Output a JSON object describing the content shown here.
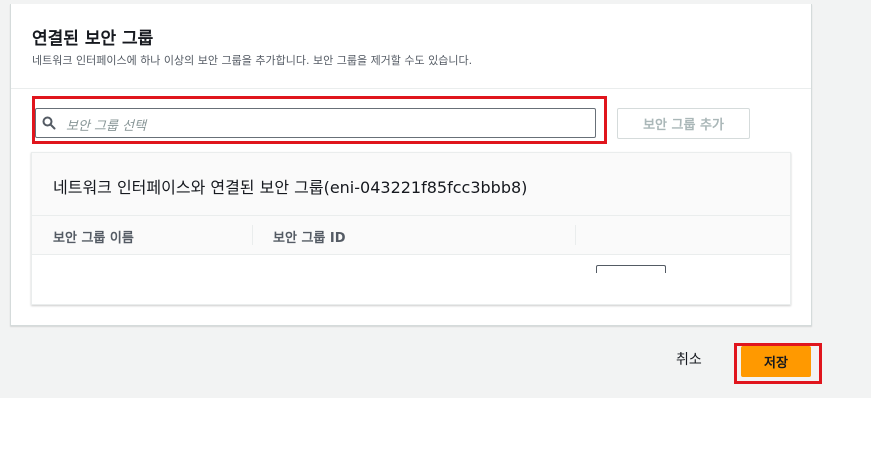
{
  "panel": {
    "title": "연결된 보안 그룹",
    "description": "네트워크 인터페이스에 하나 이상의 보안 그룹을 추가합니다. 보안 그룹을 제거할 수도 있습니다."
  },
  "search": {
    "placeholder": "보안 그룹 선택",
    "icon": "search-icon"
  },
  "add_button": {
    "label": "보안 그룹 추가"
  },
  "table": {
    "title": "네트워크 인터페이스와 연결된 보안 그룹(eni-043221f85fcc3bbb8)",
    "columns": [
      "보안 그룹 이름",
      "보안 그룹 ID"
    ]
  },
  "footer": {
    "cancel_label": "취소",
    "save_label": "저장"
  },
  "colors": {
    "primary": "#ff9900",
    "highlight": "#e0151d",
    "background": "#f2f3f3"
  }
}
